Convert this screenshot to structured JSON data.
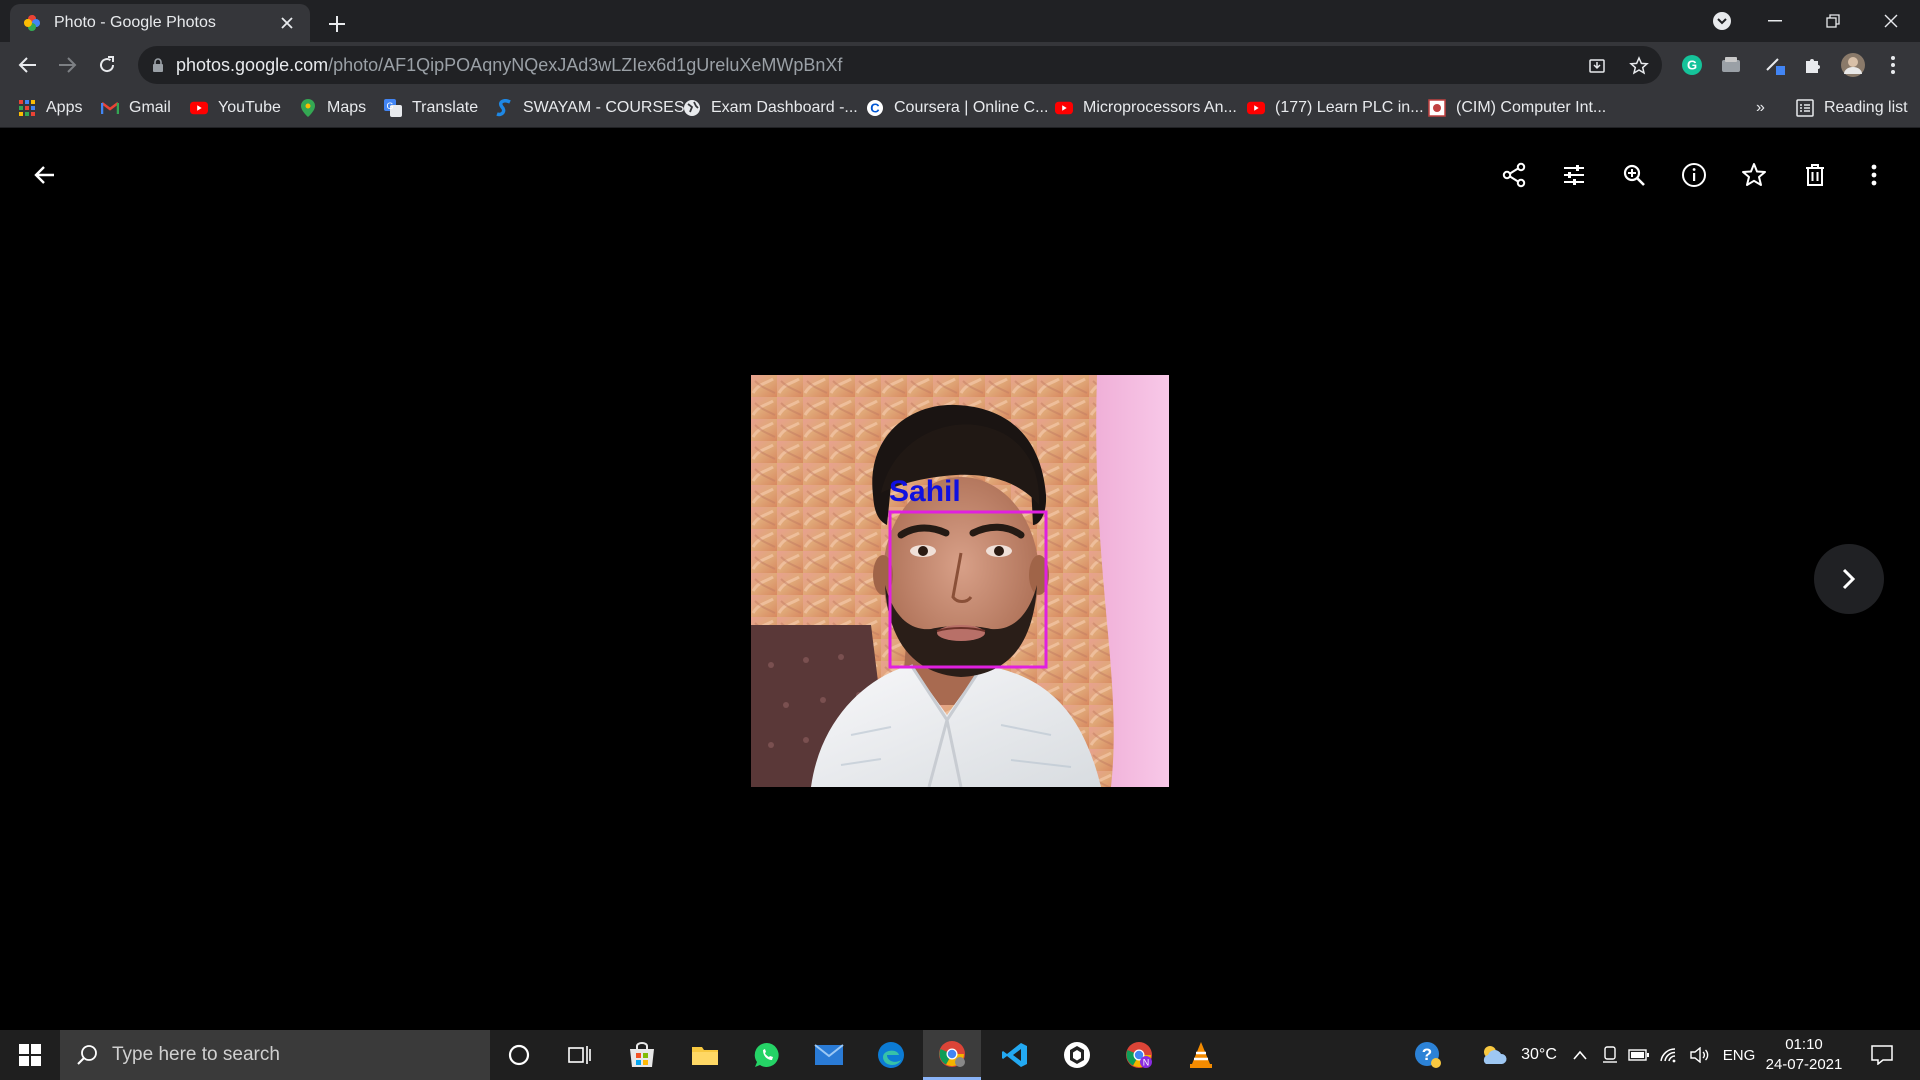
{
  "browser": {
    "tab_title": "Photo - Google Photos",
    "url_host": "photos.google.com",
    "url_path": "/photo/AF1QipPOAqnyNQexJAd3wLZIex6d1gUreluXeMWpBnXf"
  },
  "bookmarks": {
    "items": [
      {
        "label": "Apps",
        "icon": "apps-grid-icon"
      },
      {
        "label": "Gmail",
        "icon": "gmail-icon"
      },
      {
        "label": "YouTube",
        "icon": "youtube-icon"
      },
      {
        "label": "Maps",
        "icon": "maps-icon"
      },
      {
        "label": "Translate",
        "icon": "translate-icon"
      },
      {
        "label": "SWAYAM - COURSES",
        "icon": "swayam-icon"
      },
      {
        "label": "Exam Dashboard -...",
        "icon": "globe-icon"
      },
      {
        "label": "Coursera | Online C...",
        "icon": "coursera-icon"
      },
      {
        "label": "Microprocessors An...",
        "icon": "youtube-icon"
      },
      {
        "label": "(177) Learn PLC in...",
        "icon": "youtube-icon"
      },
      {
        "label": "(CIM) Computer Int...",
        "icon": "page-icon"
      }
    ],
    "overflow": "»",
    "reading_list": "Reading list"
  },
  "photo": {
    "face_label": "Sahil",
    "label_color": "#1010e0",
    "box_color": "#e020e0"
  },
  "taskbar": {
    "search_placeholder": "Type here to search",
    "weather": "30°C",
    "language": "ENG",
    "time": "01:10",
    "date": "24-07-2021"
  },
  "colors": {
    "tabstrip": "#202124",
    "toolbar": "#35363a",
    "viewer_bg": "#000000"
  }
}
